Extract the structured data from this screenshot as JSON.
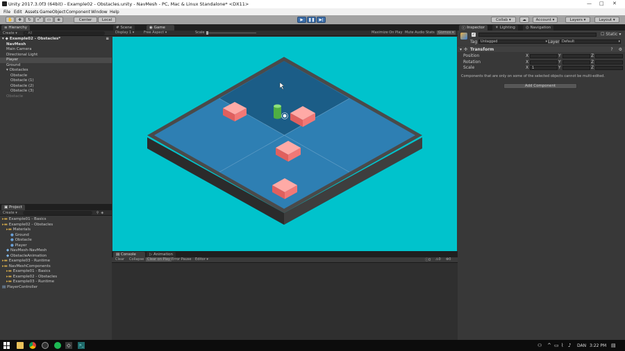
{
  "window": {
    "title": "Unity 2017.3.0f3 (64bit) - Example02 - Obstacles.unity - NavMesh - PC, Mac & Linux Standalone* <DX11>"
  },
  "menu": [
    "File",
    "Edit",
    "Assets",
    "GameObject",
    "Component",
    "Window",
    "Help"
  ],
  "toolbar": {
    "pivot_label": "Center",
    "space_label": "Local",
    "collab_label": "Collab",
    "account_label": "Account",
    "layers_label": "Layers",
    "layout_label": "Layout"
  },
  "hierarchy": {
    "tab": "Hierarchy",
    "create": "Create",
    "search_placeholder": "All",
    "scene": "Example02 - Obstacles*",
    "items": [
      {
        "label": "NavMesh",
        "indent": 1,
        "bold": true
      },
      {
        "label": "Main Camera",
        "indent": 1
      },
      {
        "label": "Directional Light",
        "indent": 1
      },
      {
        "label": "Player",
        "indent": 1,
        "selected": true
      },
      {
        "label": "Ground",
        "indent": 1
      },
      {
        "label": "Obstacles",
        "indent": 1,
        "expander": true
      },
      {
        "label": "Obstacle",
        "indent": 2
      },
      {
        "label": "Obstacle (1)",
        "indent": 2
      },
      {
        "label": "Obstacle (2)",
        "indent": 2
      },
      {
        "label": "Obstacle (3)",
        "indent": 2
      },
      {
        "label": "Obstacle",
        "indent": 1,
        "dim": true
      }
    ]
  },
  "project": {
    "tab": "Project",
    "create": "Create",
    "items": [
      {
        "label": "Example01 - Basics",
        "indent": 0,
        "type": "folder"
      },
      {
        "label": "Example02 - Obstacles",
        "indent": 0,
        "type": "folder"
      },
      {
        "label": "Materials",
        "indent": 1,
        "type": "folder"
      },
      {
        "label": "Ground",
        "indent": 2,
        "type": "material"
      },
      {
        "label": "Obstacle",
        "indent": 2,
        "type": "material"
      },
      {
        "label": "Player",
        "indent": 2,
        "type": "material"
      },
      {
        "label": "NavMesh-NavMesh",
        "indent": 1,
        "type": "asset"
      },
      {
        "label": "ObstacleAnimation",
        "indent": 1,
        "type": "asset"
      },
      {
        "label": "Example03 - Runtime",
        "indent": 0,
        "type": "folder"
      },
      {
        "label": "NavMeshComponents",
        "indent": 0,
        "type": "folder"
      },
      {
        "label": "Example01 - Basics",
        "indent": 1,
        "type": "folder"
      },
      {
        "label": "Example02 - Obstacles",
        "indent": 1,
        "type": "folder"
      },
      {
        "label": "Example03 - Runtime",
        "indent": 1,
        "type": "folder"
      },
      {
        "label": "PlayerController",
        "indent": 0,
        "type": "script"
      }
    ]
  },
  "game": {
    "tabs": [
      "Scene",
      "Game"
    ],
    "display": "Display 1",
    "aspect": "Free Aspect",
    "scale_label": "Scale",
    "options": [
      "Maximize On Play",
      "Mute Audio",
      "Stats",
      "Gizmos"
    ]
  },
  "console": {
    "tabs": [
      "Console",
      "Animation"
    ],
    "buttons": [
      "Clear",
      "Collapse",
      "Clear on Play",
      "Error Pause",
      "Editor"
    ],
    "counts": [
      "0",
      "0",
      "0"
    ]
  },
  "inspector": {
    "tabs": [
      "Inspector",
      "Lighting",
      "Navigation"
    ],
    "static_label": "Static",
    "tag_label": "Tag",
    "tag_value": "Untagged",
    "layer_label": "Layer",
    "layer_value": "Default",
    "component": "Transform",
    "rows": [
      {
        "label": "Position",
        "x": "",
        "y": "",
        "z": ""
      },
      {
        "label": "Rotation",
        "x": "",
        "y": "",
        "z": ""
      },
      {
        "label": "Scale",
        "x": "1",
        "y": "",
        "z": ""
      }
    ],
    "axis_x": "X",
    "axis_y": "Y",
    "axis_z": "Z",
    "note": "Components that are only on some of the selected objects cannot be multi-edited.",
    "add_component": "Add Component"
  },
  "taskbar": {
    "user": "DAN",
    "time": "3:22 PM"
  },
  "colors": {
    "sky": "#00c3cc",
    "floor_light": "#2e7fb3",
    "floor_dark": "#1b5d87",
    "base_dark": "#3d3d3d",
    "obstacle": "#f27876",
    "player": "#5ec24e",
    "play_active": "#3d6ea8"
  }
}
